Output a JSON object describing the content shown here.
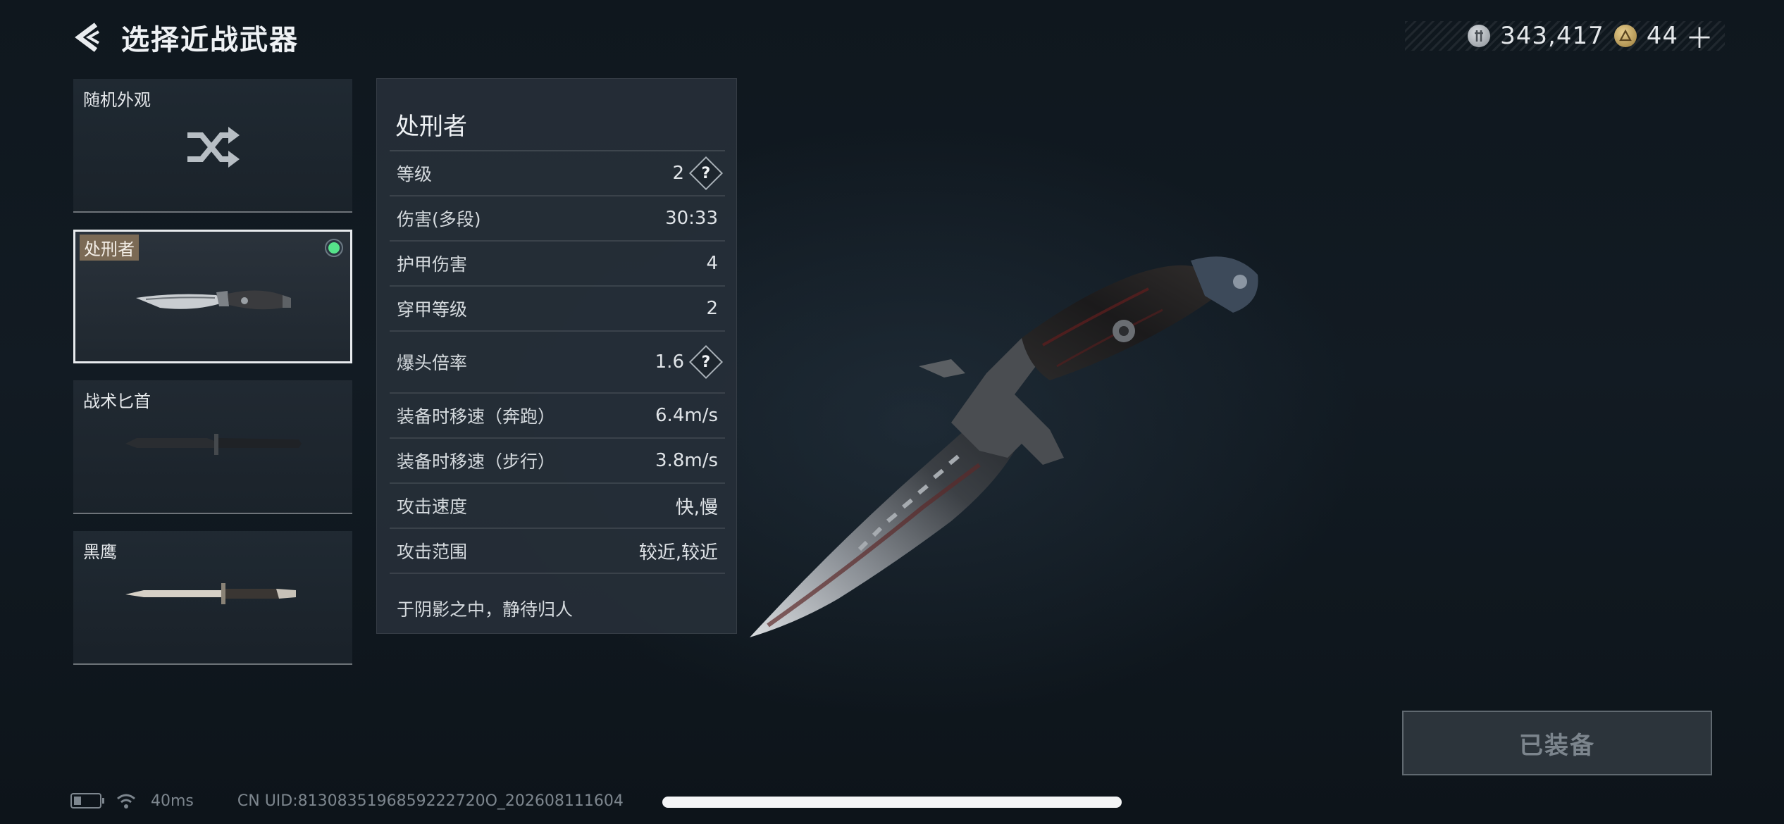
{
  "header": {
    "title": "选择近战武器",
    "back_icon": "chevron-left-icon"
  },
  "currency": {
    "silver_amount": "343,417",
    "gold_amount": "44",
    "add_label": "＋"
  },
  "weapon_list": [
    {
      "label": "随机外观",
      "icon": "shuffle-icon"
    },
    {
      "label": "处刑者",
      "selected": true,
      "equipped": true
    },
    {
      "label": "战术匕首"
    },
    {
      "label": "黑鹰"
    }
  ],
  "details": {
    "name": "处刑者",
    "stats": [
      {
        "name": "等级",
        "value": "2",
        "help": "?"
      },
      {
        "name": "伤害(多段)",
        "value": "30:33"
      },
      {
        "name": "护甲伤害",
        "value": "4"
      },
      {
        "name": "穿甲等级",
        "value": "2"
      },
      {
        "name": "爆头倍率",
        "value": "1.6",
        "help": "?"
      },
      {
        "name": "装备时移速（奔跑）",
        "value": "6.4m/s"
      },
      {
        "name": "装备时移速（步行）",
        "value": "3.8m/s"
      },
      {
        "name": "攻击速度",
        "value": "快,慢"
      },
      {
        "name": "攻击范围",
        "value": "较近,较近"
      }
    ],
    "description": "于阴影之中，静待归人"
  },
  "equip_button": {
    "label": "已装备"
  },
  "footer": {
    "ping": "40ms",
    "uid": "CN UID:8130835196859222720O_202608111604"
  },
  "colors": {
    "equipped_dot": "#56e38b",
    "selected_label_bg": "#7b6a55"
  }
}
